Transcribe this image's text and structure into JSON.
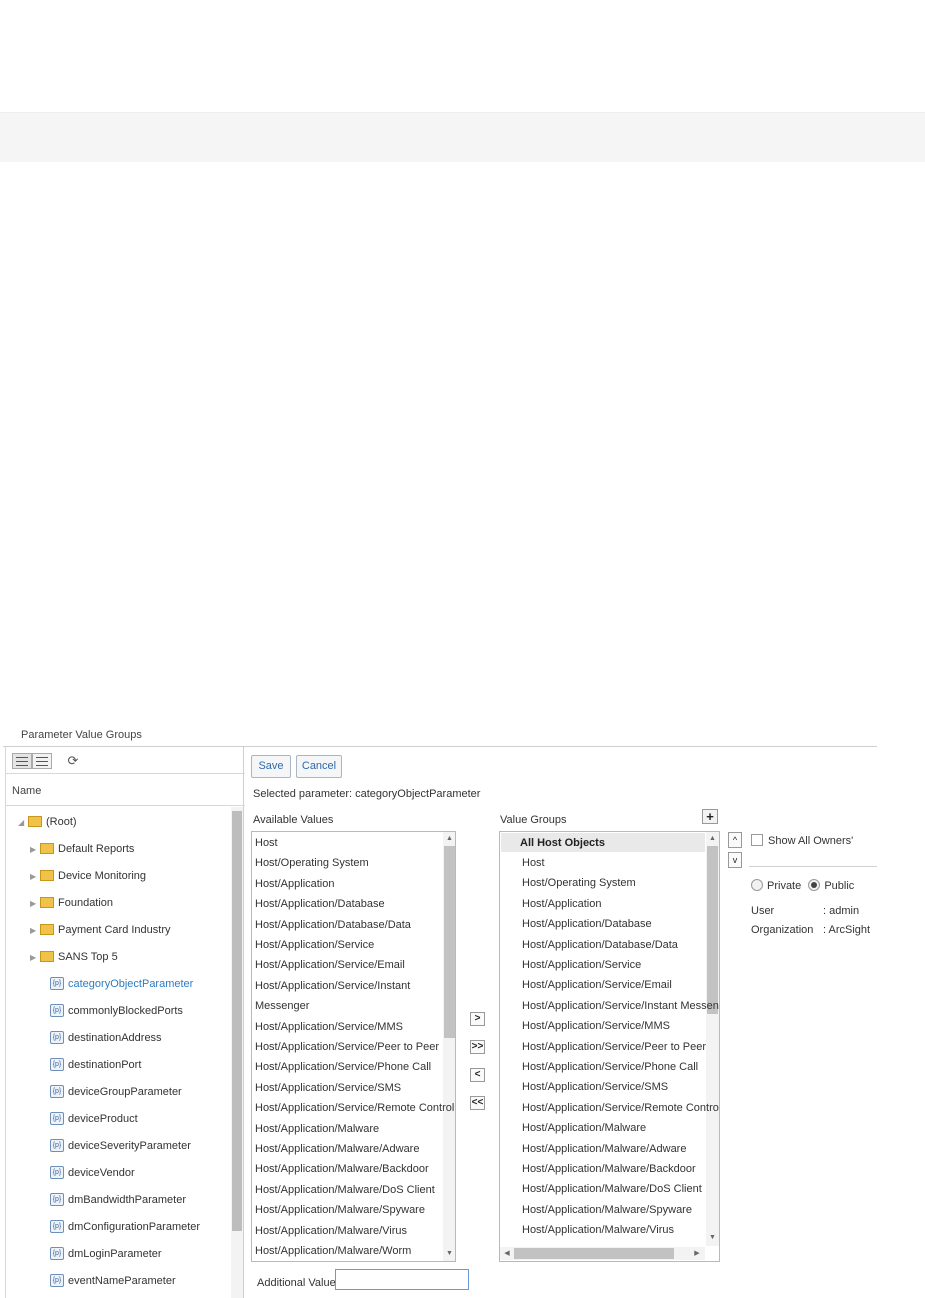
{
  "panel": {
    "title": "Parameter Value Groups"
  },
  "tree": {
    "header": "Name",
    "items": [
      {
        "label": "(Root)",
        "type": "folder",
        "expanded": true
      },
      {
        "label": "Default Reports",
        "type": "folder"
      },
      {
        "label": "Device Monitoring",
        "type": "folder"
      },
      {
        "label": "Foundation",
        "type": "folder"
      },
      {
        "label": "Payment Card Industry",
        "type": "folder"
      },
      {
        "label": "SANS Top 5",
        "type": "folder"
      },
      {
        "label": "categoryObjectParameter",
        "type": "parameter",
        "selected": true
      },
      {
        "label": "commonlyBlockedPorts",
        "type": "parameter"
      },
      {
        "label": "destinationAddress",
        "type": "parameter"
      },
      {
        "label": "destinationPort",
        "type": "parameter"
      },
      {
        "label": "deviceGroupParameter",
        "type": "parameter"
      },
      {
        "label": "deviceProduct",
        "type": "parameter"
      },
      {
        "label": "deviceSeverityParameter",
        "type": "parameter"
      },
      {
        "label": "deviceVendor",
        "type": "parameter"
      },
      {
        "label": "dmBandwidthParameter",
        "type": "parameter"
      },
      {
        "label": "dmConfigurationParameter",
        "type": "parameter"
      },
      {
        "label": "dmLoginParameter",
        "type": "parameter"
      },
      {
        "label": "eventNameParameter",
        "type": "parameter"
      }
    ]
  },
  "toolbar": {
    "save_label": "Save",
    "cancel_label": "Cancel"
  },
  "selected_parameter": "Selected parameter: categoryObjectParameter",
  "available": {
    "label": "Available Values",
    "items": [
      "Host",
      "Host/Operating System",
      "Host/Application",
      "Host/Application/Database",
      "Host/Application/Database/Data",
      "Host/Application/Service",
      "Host/Application/Service/Email",
      "Host/Application/Service/Instant",
      "Messenger",
      "Host/Application/Service/MMS",
      "Host/Application/Service/Peer to Peer",
      "Host/Application/Service/Phone Call",
      "Host/Application/Service/SMS",
      "Host/Application/Service/Remote Control",
      "Host/Application/Malware",
      "Host/Application/Malware/Adware",
      "Host/Application/Malware/Backdoor",
      "Host/Application/Malware/DoS Client",
      "Host/Application/Malware/Spyware",
      "Host/Application/Malware/Virus",
      "Host/Application/Malware/Worm"
    ]
  },
  "groups": {
    "label": "Value Groups",
    "head": "All Host Objects",
    "items": [
      "Host",
      "Host/Operating System",
      "Host/Application",
      "Host/Application/Database",
      "Host/Application/Database/Data",
      "Host/Application/Service",
      "Host/Application/Service/Email",
      "Host/Application/Service/Instant Messeng",
      "Host/Application/Service/MMS",
      "Host/Application/Service/Peer to Peer",
      "Host/Application/Service/Phone Call",
      "Host/Application/Service/SMS",
      "Host/Application/Service/Remote Contro",
      "Host/Application/Malware",
      "Host/Application/Malware/Adware",
      "Host/Application/Malware/Backdoor",
      "Host/Application/Malware/DoS Client",
      "Host/Application/Malware/Spyware",
      "Host/Application/Malware/Virus"
    ]
  },
  "move_buttons": [
    ">",
    ">>",
    "<",
    "<<"
  ],
  "owners": {
    "show_all_label": "Show All Owners'",
    "private_label": "Private",
    "public_label": "Public",
    "user_key": "User",
    "user_value": ": admin",
    "org_key": "Organization",
    "org_value": ": ArcSight"
  },
  "additional": {
    "label": "Additional Value",
    "value": ""
  }
}
